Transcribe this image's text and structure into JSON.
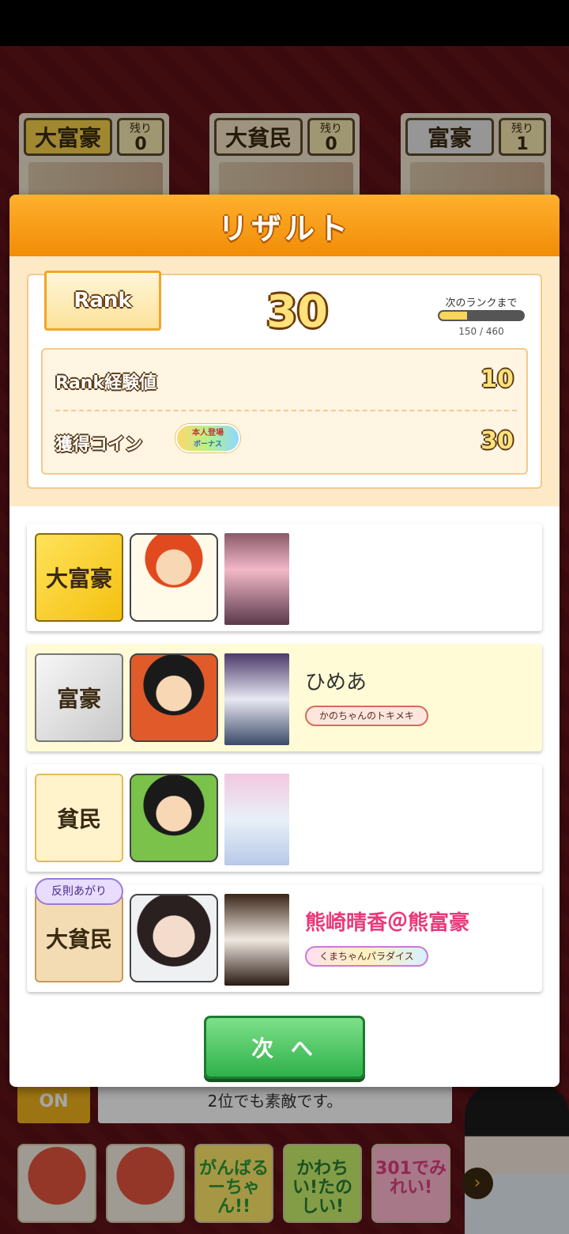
{
  "background": {
    "top_players": [
      {
        "rank": "大富豪",
        "remain_label": "残り",
        "remain_count": "0"
      },
      {
        "rank": "大貧民",
        "remain_label": "残り",
        "remain_count": "0"
      },
      {
        "rank": "富豪",
        "remain_label": "残り",
        "remain_count": "1"
      }
    ],
    "auto_label": "ON",
    "message": "2位でも素敵です。",
    "stamps": [
      "がんばるーちゃん!!",
      "かわちい!たのしい!",
      "301でみれい!"
    ]
  },
  "modal": {
    "title": "リザルト",
    "rank": {
      "label": "Rank",
      "value": "30",
      "next_label": "次のランクまで",
      "progress_text": "150 / 460",
      "progress_fraction": 0.326
    },
    "rewards": [
      {
        "label": "Rank経験値",
        "value": "10"
      },
      {
        "label": "獲得コイン",
        "value": "30",
        "bonus": {
          "line1": "本人登場",
          "line2": "ボーナス"
        }
      }
    ],
    "players": [
      {
        "rank": "大富豪",
        "name": "",
        "title": "",
        "highlight": false
      },
      {
        "rank": "富豪",
        "name": "ひめあ",
        "title": "かのちゃんのトキメキ",
        "highlight": true
      },
      {
        "rank": "貧民",
        "name": "",
        "title": "",
        "highlight": false
      },
      {
        "rank": "大貧民",
        "name": "熊崎晴香＠熊富豪",
        "title": "くまちゃんパラダイス",
        "foul": "反則あがり",
        "highlight": false
      }
    ],
    "next_button": "次 へ"
  }
}
